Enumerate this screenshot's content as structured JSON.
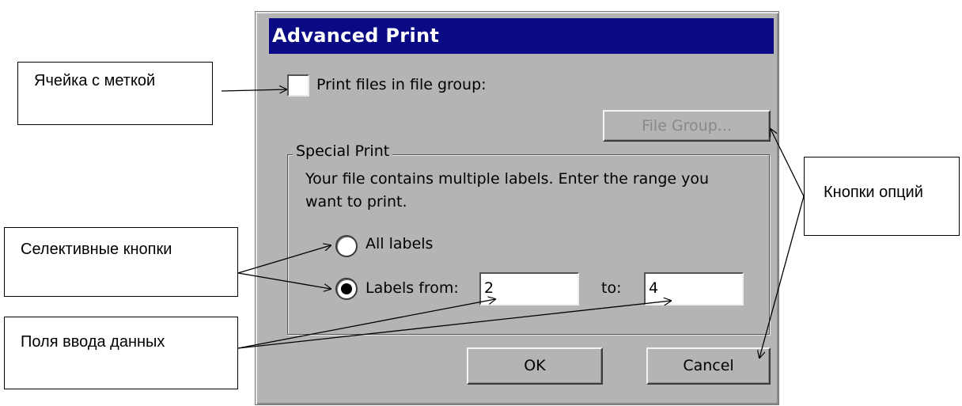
{
  "dialog": {
    "title": "Advanced Print",
    "print_files_checkbox": {
      "label": "Print files in file group:",
      "checked": false
    },
    "file_group_button": "File Group...",
    "special_print": {
      "legend": "Special Print",
      "instructions_line1": "Your file contains multiple labels. Enter the range you",
      "instructions_line2": "want to print.",
      "all_labels_radio": {
        "label": "All labels",
        "selected": false
      },
      "labels_from_radio": {
        "label": "Labels from:",
        "selected": true
      },
      "from_value": "2",
      "to_label": "to:",
      "to_value": "4"
    },
    "ok_button": "OK",
    "cancel_button": "Cancel"
  },
  "callouts": {
    "checkbox_cell": "Ячейка с меткой",
    "radio_buttons": "Селективные кнопки",
    "input_fields": "Поля ввода данных",
    "option_buttons": "Кнопки опций"
  },
  "colors": {
    "titlebar": "#0a0a84",
    "dialog_face": "#b4b4b4"
  }
}
